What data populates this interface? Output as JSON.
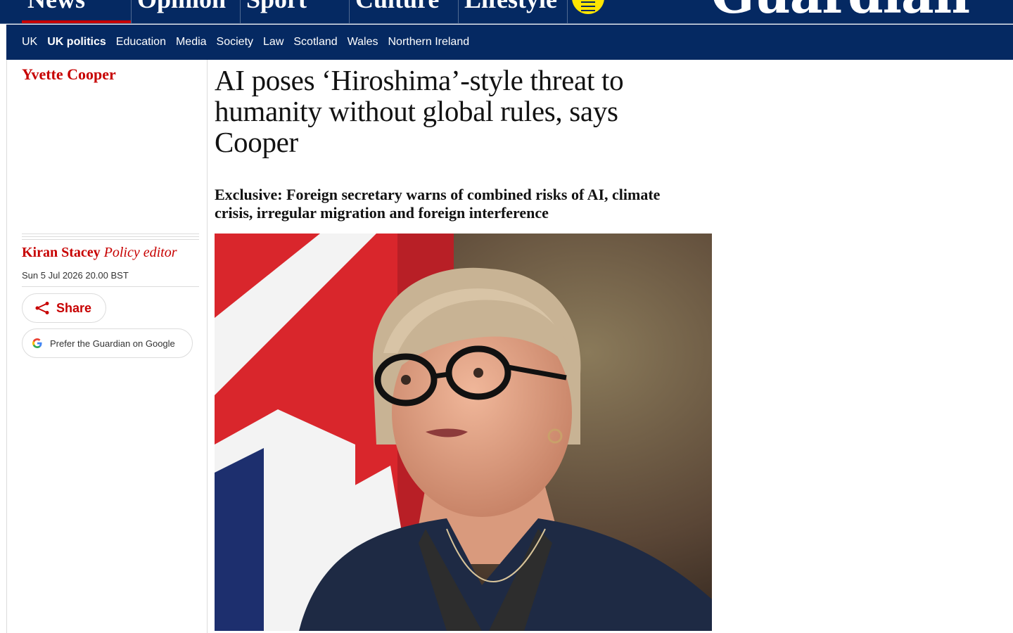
{
  "header": {
    "pillars": [
      {
        "label": "News",
        "active": true
      },
      {
        "label": "Opinion",
        "active": false
      },
      {
        "label": "Sport",
        "active": false
      },
      {
        "label": "Culture",
        "active": false
      },
      {
        "label": "Lifestyle",
        "active": false
      }
    ],
    "logo_text": "Guardian",
    "subnav": [
      "UK",
      "UK politics",
      "Education",
      "Media",
      "Society",
      "Law",
      "Scotland",
      "Wales",
      "Northern Ireland"
    ],
    "subnav_active": "UK politics"
  },
  "article": {
    "series": "Yvette Cooper",
    "headline": "AI poses ‘Hiroshima’-style threat to humanity without global rules, says Cooper",
    "standfirst": "Exclusive: Foreign secretary warns of combined risks of AI, climate crisis, irregular migration and foreign interference",
    "author": "Kiran Stacey",
    "author_role": "Policy editor",
    "date": "Sun 5 Jul 2026 20.00 BST",
    "share_label": "Share",
    "prefer_label": "Prefer the Guardian on Google"
  },
  "colors": {
    "brand_navy": "#052962",
    "news_red": "#c70000",
    "menu_yellow": "#ffe500"
  },
  "icons": [
    "share-icon",
    "google-icon",
    "menu-icon"
  ]
}
